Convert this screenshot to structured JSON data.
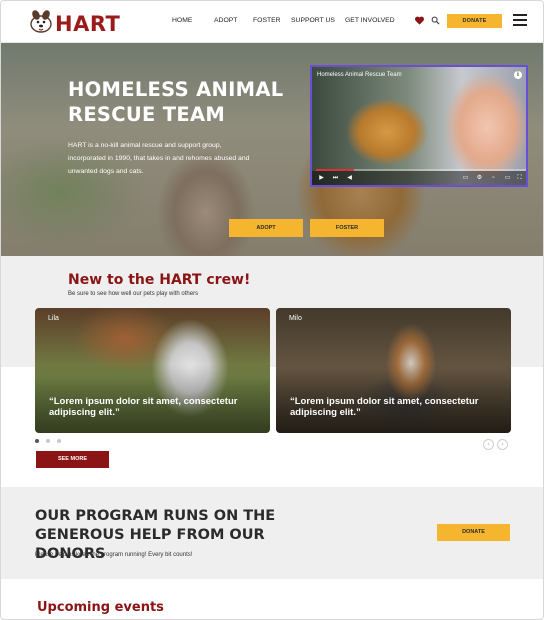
{
  "header": {
    "logo_text": "HART",
    "nav": [
      "HOME",
      "ADOPT",
      "FOSTER",
      "SUPPORT US",
      "GET INVOLVED"
    ],
    "donate_label": "DONATE",
    "icons": [
      "heart-icon",
      "search-icon",
      "menu-icon"
    ]
  },
  "hero": {
    "title": "HOMELESS ANIMAL RESCUE TEAM",
    "description": "HART is a no-kill animal rescue and support group, incorporated in 1990, that takes in and rehomes abused and unwanted dogs and cats.",
    "adopt_label": "ADOPT",
    "foster_label": "FOSTER",
    "video": {
      "title": "Homeless Animal Rescue Team",
      "progress": 0.18
    }
  },
  "crew": {
    "title": "New to the HART crew!",
    "subtitle": "Be sure to see how well our pets play with others",
    "cards": [
      {
        "name": "Lila",
        "quote": "“Lorem ipsum dolor sit amet, consectetur adipiscing elit.”"
      },
      {
        "name": "Milo",
        "quote": "“Lorem ipsum dolor sit amet, consectetur adipiscing elit.”"
      }
    ],
    "carousel_pages": 3,
    "carousel_active": 1,
    "see_more_label": "SEE MORE"
  },
  "donors": {
    "title": "OUR PROGRAM RUNS ON THE GENEROUS HELP FROM OUR DONORS",
    "subtitle": "Please help us keep the program running! Every bit counts!",
    "donate_label": "DONATE"
  },
  "events": {
    "title": "Upcoming events"
  },
  "colors": {
    "brand_red": "#8b1414",
    "accent_yellow": "#f5b52e",
    "section_gray": "#efefef"
  }
}
